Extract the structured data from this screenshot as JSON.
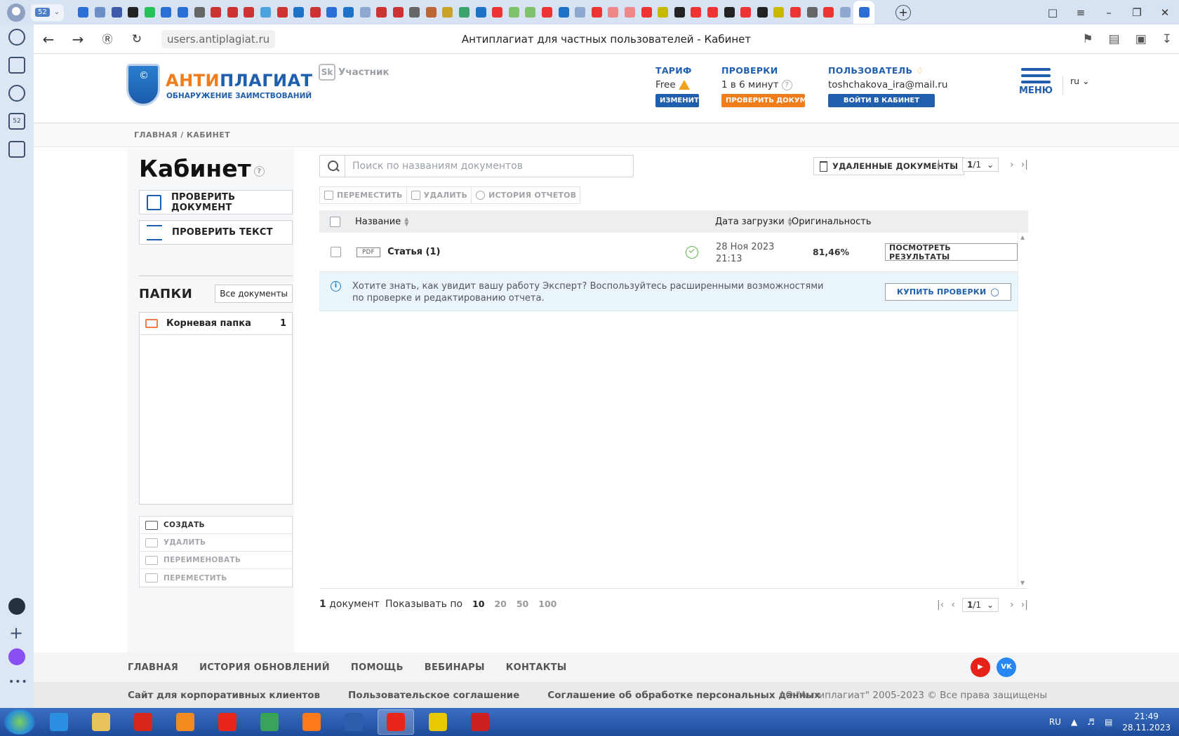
{
  "browser": {
    "counter_tab": "52",
    "url": "users.antiplagiat.ru",
    "page_title": "Антиплагиат для частных пользователей - Кабинет",
    "tab_colors": [
      "#2b6fd6",
      "#6c8ec7",
      "#3d5aa8",
      "#222",
      "#25c25a",
      "#2b6fd6",
      "#2b6fd6",
      "#666",
      "#c33",
      "#c33",
      "#c33",
      "#4aa3df",
      "#c33",
      "#1e73c9",
      "#c33",
      "#2b6fd6",
      "#1e73c9",
      "#8fa8d0",
      "#c33",
      "#c33",
      "#666",
      "#b63",
      "#c9a227",
      "#3aa36e",
      "#1e73c9",
      "#e33",
      "#7ec36b",
      "#7ec36b",
      "#e33",
      "#1e73c9",
      "#8fa8d0",
      "#e33",
      "#e88",
      "#e88",
      "#e33",
      "#c9b800",
      "#222",
      "#e33",
      "#e33",
      "#222",
      "#e33",
      "#222",
      "#c9b800",
      "#e33",
      "#666",
      "#e33",
      "#8fa8d0"
    ]
  },
  "header": {
    "logo_orange": "АНТИ",
    "logo_blue": "ПЛАГИАТ",
    "logo_tagline": "ОБНАРУЖЕНИЕ ЗАИМСТВОВАНИЙ",
    "sk_text": "Участник",
    "tariff": {
      "label": "ТАРИФ",
      "value": "Free",
      "button": "ИЗМЕНИТЬ"
    },
    "checks": {
      "label": "ПРОВЕРКИ",
      "value": "1 в 6 минут",
      "button": "ПРОВЕРИТЬ ДОКУМЕНТ"
    },
    "user": {
      "label": "ПОЛЬЗОВАТЕЛЬ",
      "email": "toshchakova_ira@mail.ru",
      "button": "ВОЙТИ В КАБИНЕТ"
    },
    "menu_label": "МЕНЮ",
    "lang": "ru",
    "colors": {
      "blue": "#1f5fae",
      "orange": "#f07d1c",
      "warning": "#f0a21c"
    }
  },
  "breadcrumbs": "ГЛАВНАЯ  /  КАБИНЕТ",
  "cabinet": {
    "title": "Кабинет",
    "check_document": "ПРОВЕРИТЬ ДОКУМЕНТ",
    "check_text": "ПРОВЕРИТЬ ТЕКСТ",
    "folders_title": "ПАПКИ",
    "all_documents": "Все документы",
    "folders": [
      {
        "name": "Корневая папка",
        "count": "1"
      }
    ],
    "folder_actions": {
      "create": "СОЗДАТЬ",
      "delete": "УДАЛИТЬ",
      "rename": "ПЕРЕИМЕНОВАТЬ",
      "move": "ПЕРЕМЕСТИТЬ"
    }
  },
  "documents": {
    "search_placeholder": "Поиск по названиям документов",
    "deleted_documents": "УДАЛЕННЫЕ ДОКУМЕНТЫ",
    "pager": {
      "current": "1",
      "total": "/1"
    },
    "toolbar": {
      "move": "ПЕРЕМЕСТИТЬ",
      "delete": "УДАЛИТЬ",
      "history": "ИСТОРИЯ ОТЧЕТОВ"
    },
    "columns": {
      "name": "Название",
      "date": "Дата загрузки",
      "originality": "Оригинальность"
    },
    "rows": [
      {
        "type": "PDF",
        "title": "Статья (1)",
        "date": "28 Ноя 2023",
        "time": "21:13",
        "originality": "81,46%",
        "action": "ПОСМОТРЕТЬ РЕЗУЛЬТАТЫ"
      }
    ],
    "promo": {
      "text": "Хотите знать, как увидит вашу работу Эксперт? Воспользуйтесь расширенными возможностями по проверке и редактированию отчета.",
      "button": "КУПИТЬ ПРОВЕРКИ"
    },
    "count_number": "1",
    "count_label": " документ",
    "show_by_label": "Показывать по",
    "page_sizes": [
      "10",
      "20",
      "50",
      "100"
    ]
  },
  "footer": {
    "nav": [
      "ГЛАВНАЯ",
      "ИСТОРИЯ ОБНОВЛЕНИЙ",
      "ПОМОЩЬ",
      "ВЕБИНАРЫ",
      "КОНТАКТЫ"
    ],
    "social_vk": "VK",
    "links": [
      "Сайт для корпоративных клиентов",
      "Пользовательское соглашение",
      "Соглашение об обработке персональных данных"
    ],
    "copyright": "АО \"Антиплагиат\" 2005-2023 © Все права защищены"
  },
  "taskbar": {
    "lang": "RU",
    "time": "21:49",
    "date": "28.11.2023",
    "app_colors": [
      "#2a8fe0",
      "#e8c25a",
      "#d8261a",
      "#f28b20",
      "#e8261a",
      "#3aa35a",
      "#ff7a1a",
      "#2b5fae",
      "#e8261a",
      "#e8c800",
      "#cc1f1f"
    ]
  }
}
